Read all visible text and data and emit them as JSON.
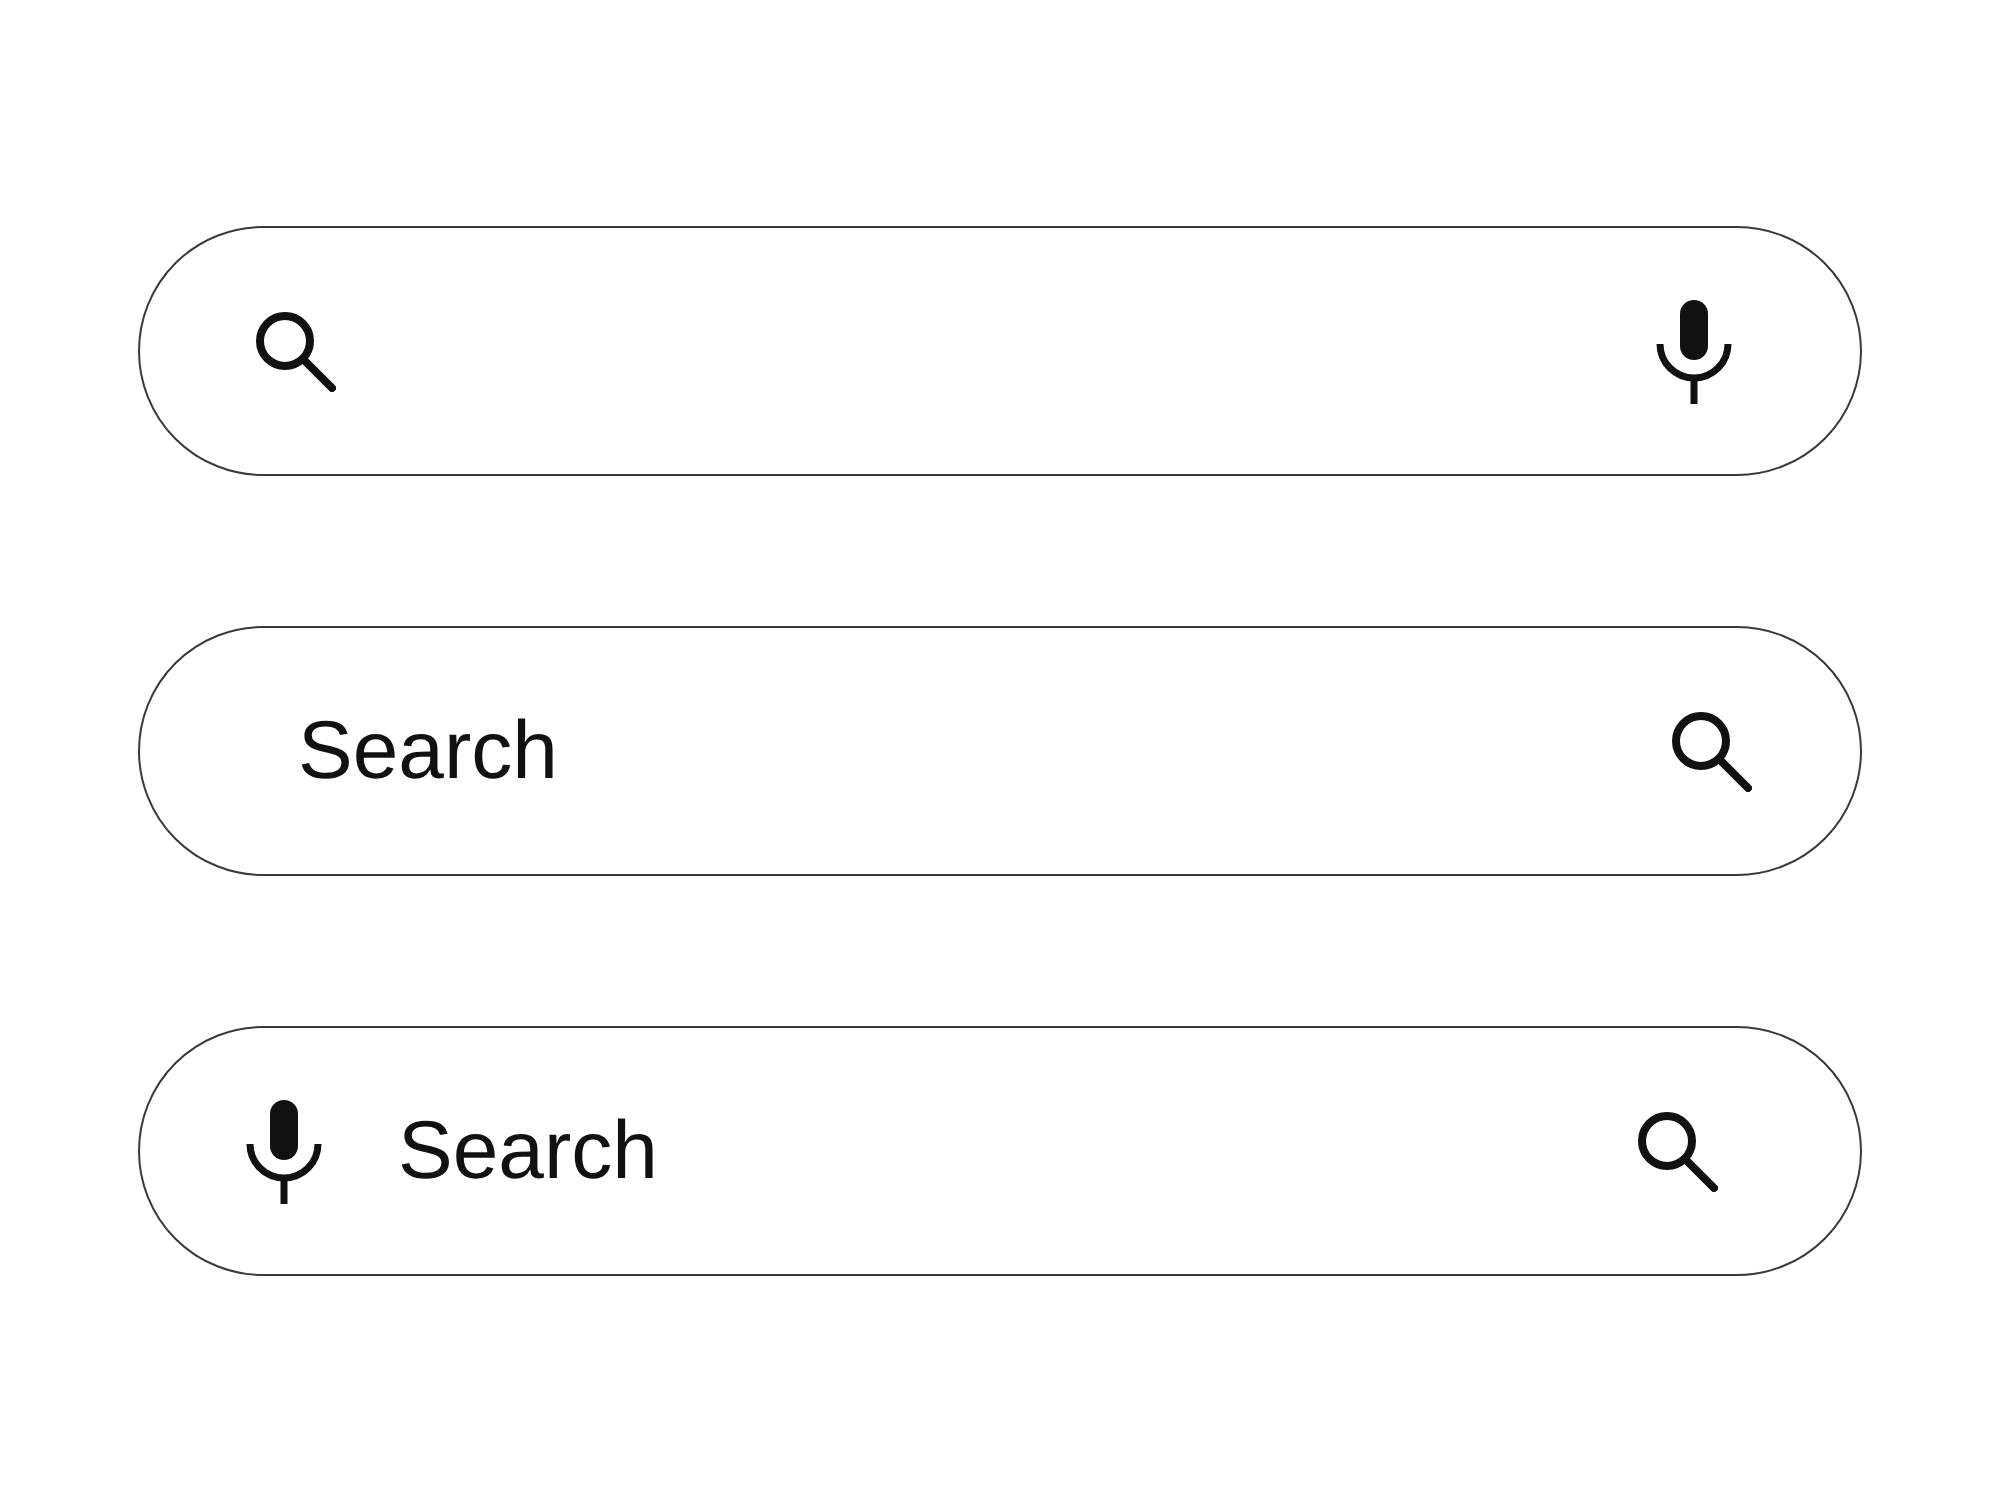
{
  "search_bars": [
    {
      "kind": "blank"
    },
    {
      "kind": "plain",
      "placeholder": "Search"
    },
    {
      "kind": "voice",
      "placeholder": "Search"
    }
  ]
}
